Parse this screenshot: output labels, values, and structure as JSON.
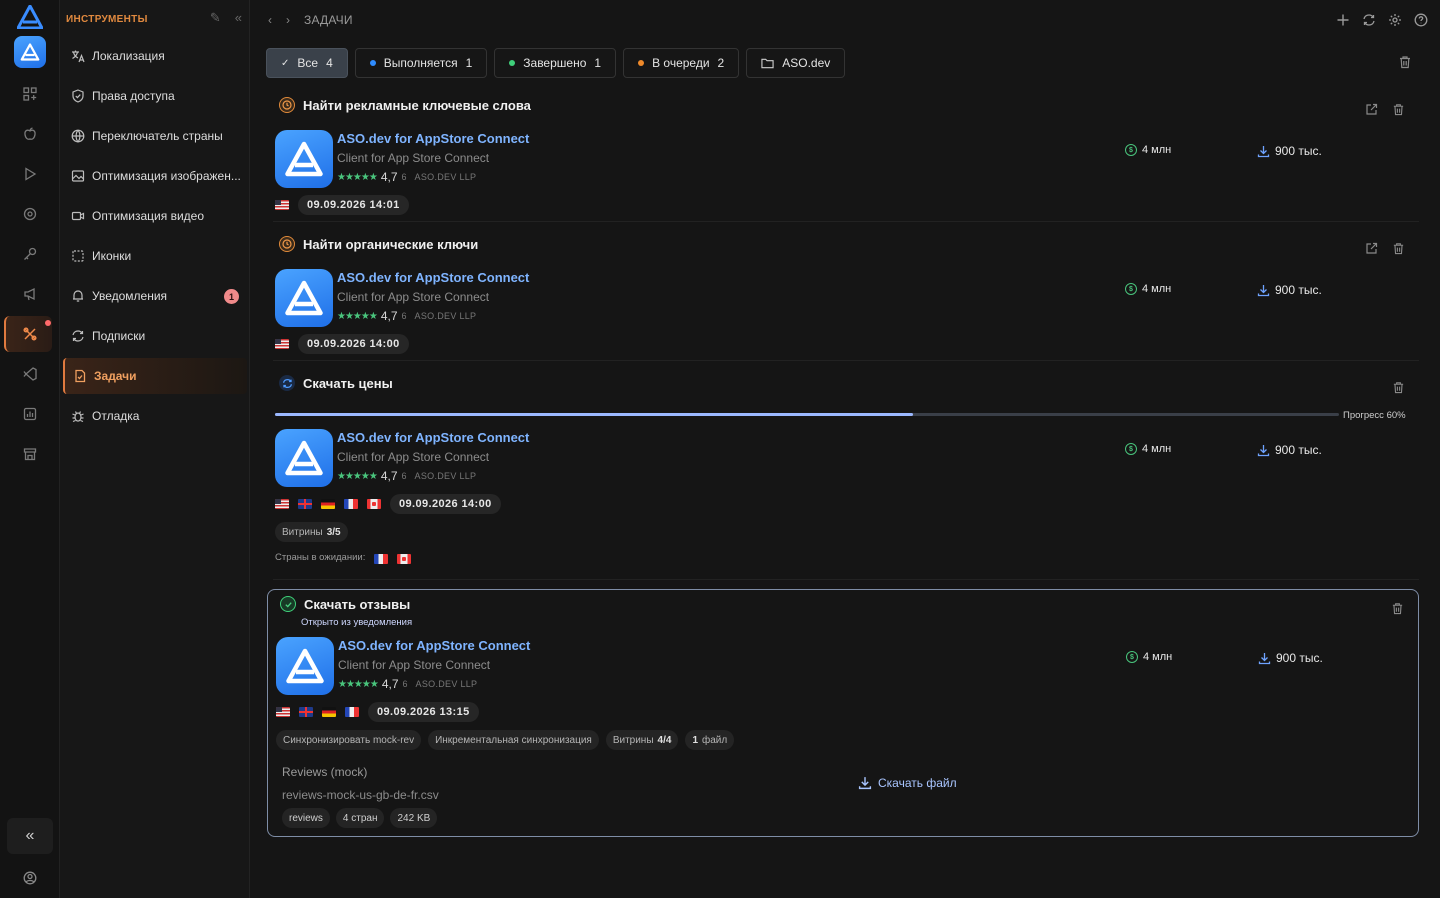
{
  "sidebar": {
    "title": "ИНСТРУМЕНТЫ",
    "items": [
      {
        "label": "Локализация",
        "icon": "translate-icon"
      },
      {
        "label": "Права доступа",
        "icon": "shield-icon"
      },
      {
        "label": "Переключатель страны",
        "icon": "globe-icon"
      },
      {
        "label": "Оптимизация изображен...",
        "icon": "image-icon"
      },
      {
        "label": "Оптимизация видео",
        "icon": "video-icon"
      },
      {
        "label": "Иконки",
        "icon": "icons-icon"
      },
      {
        "label": "Уведомления",
        "icon": "bell-icon",
        "badge": "1"
      },
      {
        "label": "Подписки",
        "icon": "refresh-icon"
      },
      {
        "label": "Задачи",
        "icon": "task-icon",
        "active": true
      },
      {
        "label": "Отладка",
        "icon": "bug-icon"
      }
    ]
  },
  "header": {
    "breadcrumb": "ЗАДАЧИ"
  },
  "filters": [
    {
      "label": "Все",
      "count": "4",
      "selected": true
    },
    {
      "label": "Выполняется",
      "count": "1",
      "dot": "#2f8cff"
    },
    {
      "label": "Завершено",
      "count": "1",
      "dot": "#3fd07a"
    },
    {
      "label": "В очереди",
      "count": "2",
      "dot": "#f08a2a"
    },
    {
      "label": "ASO.dev",
      "count": ""
    }
  ],
  "app": {
    "name": "ASO.dev for AppStore Connect",
    "subtitle": "Client for App Store Connect",
    "stars": "★★★★★",
    "rating": "4,7",
    "rating_count": "6",
    "developer": "ASO.DEV LLP",
    "revenue": "4 млн",
    "downloads": "900 тыс."
  },
  "tasks": [
    {
      "title": "Найти рекламные ключевые слова",
      "date": "09.09.2026 14:01",
      "status": "queued"
    },
    {
      "title": "Найти органические ключи",
      "date": "09.09.2026 14:00",
      "status": "queued"
    },
    {
      "title": "Скачать цены",
      "date": "09.09.2026 14:00",
      "status": "running",
      "progress": 0.6,
      "progress_label": "Прогресс 60%",
      "storefronts_label": "Витрины",
      "storefronts_value": "3/5",
      "pending_label": "Страны в ожидании:"
    },
    {
      "title": "Скачать отзывы",
      "note": "Открыто из уведомления",
      "date": "09.09.2026 13:15",
      "status": "done",
      "tags": [
        "Синхронизировать mock-rev",
        "Инкрементальная синхронизация"
      ],
      "storefronts_label": "Витрины",
      "storefronts_value": "4/4",
      "files_count": "1",
      "files_label": "файл",
      "file": {
        "name": "Reviews (mock)",
        "path": "reviews-mock-us-gb-de-fr.csv",
        "tags": [
          "reviews",
          "4 стран",
          "242 KB"
        ]
      },
      "download_label": "Скачать файл"
    }
  ],
  "colors": {
    "accent": "#e07a3f",
    "link": "#7fb4ff",
    "success": "#49c47c"
  }
}
